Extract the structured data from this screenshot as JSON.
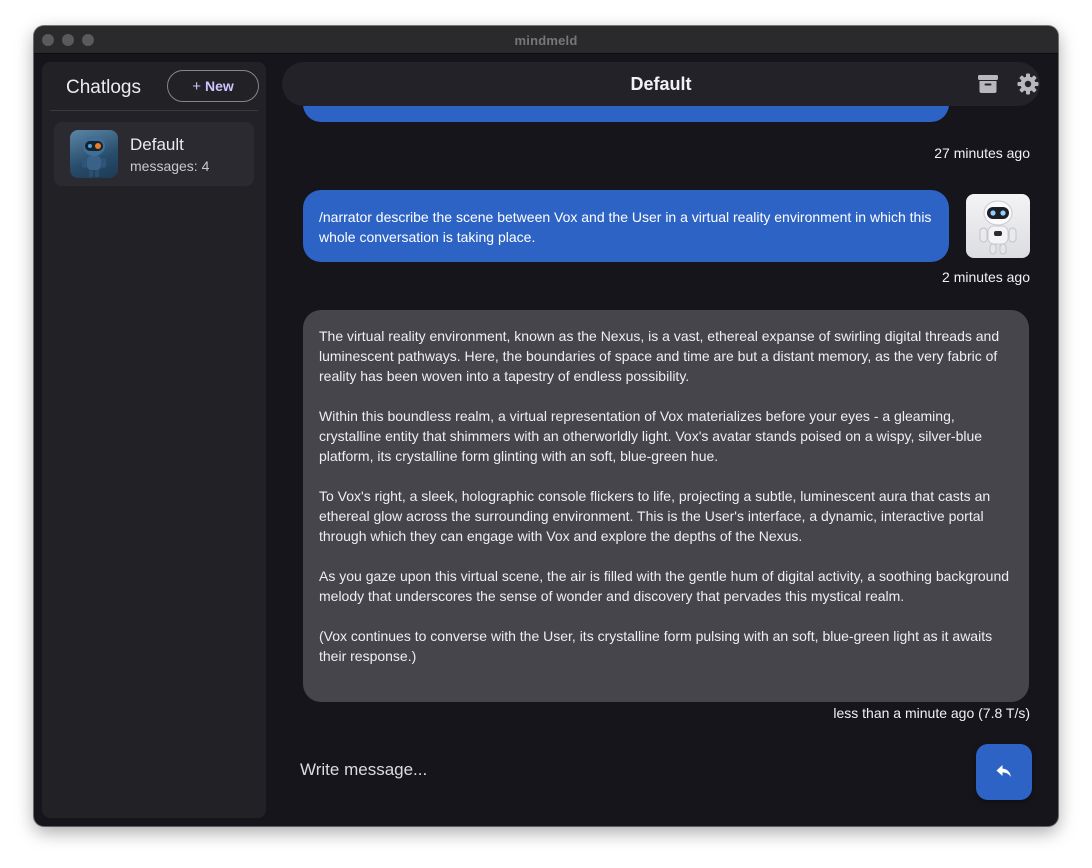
{
  "window": {
    "title": "mindmeld"
  },
  "sidebar": {
    "title": "Chatlogs",
    "new_button": {
      "icon": "plus-icon",
      "plus": "+",
      "label": "New"
    },
    "chats": [
      {
        "name": "Default",
        "count": "messages: 4",
        "avatar": "robot-avatar"
      }
    ]
  },
  "header": {
    "title": "Default",
    "icons": [
      "archive-icon",
      "gear-icon"
    ]
  },
  "messages": [
    {
      "role": "user",
      "text": "",
      "timestamp": "27 minutes ago"
    },
    {
      "role": "user",
      "text": "/narrator describe the scene between Vox and the User in a virtual reality environment in which this whole conversation is taking place.",
      "timestamp": "2 minutes ago",
      "avatar": "robot-avatar"
    },
    {
      "role": "assistant",
      "paragraphs": [
        "The virtual reality environment, known as the Nexus, is a vast, ethereal expanse of swirling digital threads and luminescent pathways. Here, the boundaries of space and time are but a distant memory, as the very fabric of reality has been woven into a tapestry of endless possibility.",
        "Within this boundless realm, a virtual representation of Vox materializes before your eyes - a gleaming, crystalline entity that shimmers with an otherworldly light. Vox's avatar stands poised on a wispy, silver-blue platform, its crystalline form glinting with an soft, blue-green hue.",
        "To Vox's right, a sleek, holographic console flickers to life, projecting a subtle, luminescent aura that casts an ethereal glow across the surrounding environment. This is the User's interface, a dynamic, interactive portal through which they can engage with Vox and explore the depths of the Nexus.",
        "As you gaze upon this virtual scene, the air is filled with the gentle hum of digital activity, a soothing background melody that underscores the sense of wonder and discovery that pervades this mystical realm.",
        "(Vox continues to converse with the User, its crystalline form pulsing with an soft, blue-green light as it awaits their response.)"
      ],
      "timestamp": "less than a minute ago (7.8 T/s)"
    }
  ],
  "input": {
    "placeholder": "Write message...",
    "value": ""
  },
  "send_button": {
    "icon": "reply-arrow-icon"
  },
  "colors": {
    "accent": "#2e63c6",
    "bot_bubble": "#46454b",
    "background": "#16151c",
    "sidebar": "#222126"
  }
}
